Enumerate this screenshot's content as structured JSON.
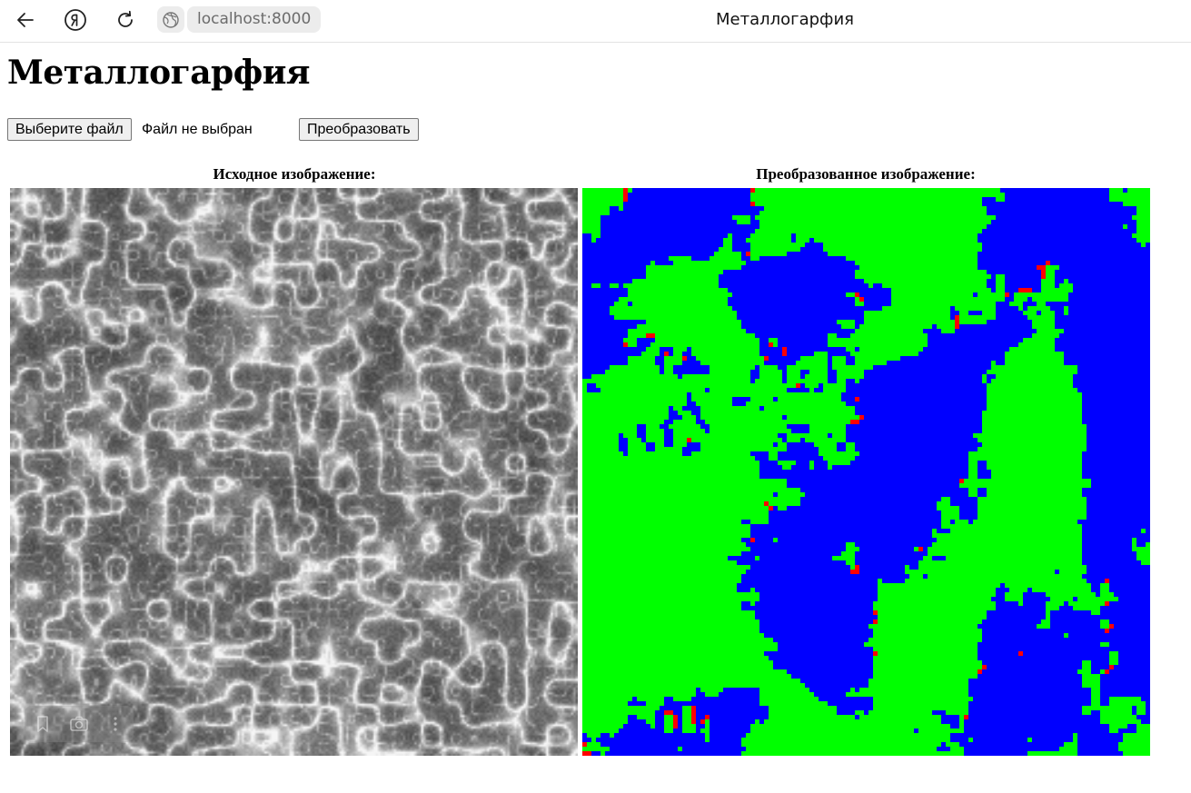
{
  "browser": {
    "url": "localhost:8000",
    "tab_title": "Металлогарфия"
  },
  "page": {
    "heading": "Металлогарфия",
    "file_button_label": "Выберите файл",
    "file_status": "Файл не выбран",
    "convert_button_label": "Преобразовать",
    "original_caption": "Исходное изображение:",
    "converted_caption": "Преобразованное изображение:"
  },
  "colors": {
    "phase_background": "#0000ff",
    "phase_primary": "#00ff00",
    "phase_secondary": "#ff0000",
    "micrograph_base": "#808080"
  },
  "icons": [
    "back-arrow-icon",
    "yandex-icon",
    "reload-icon",
    "site-globe-icon",
    "bookmark-icon",
    "camera-icon",
    "more-dots-icon"
  ]
}
